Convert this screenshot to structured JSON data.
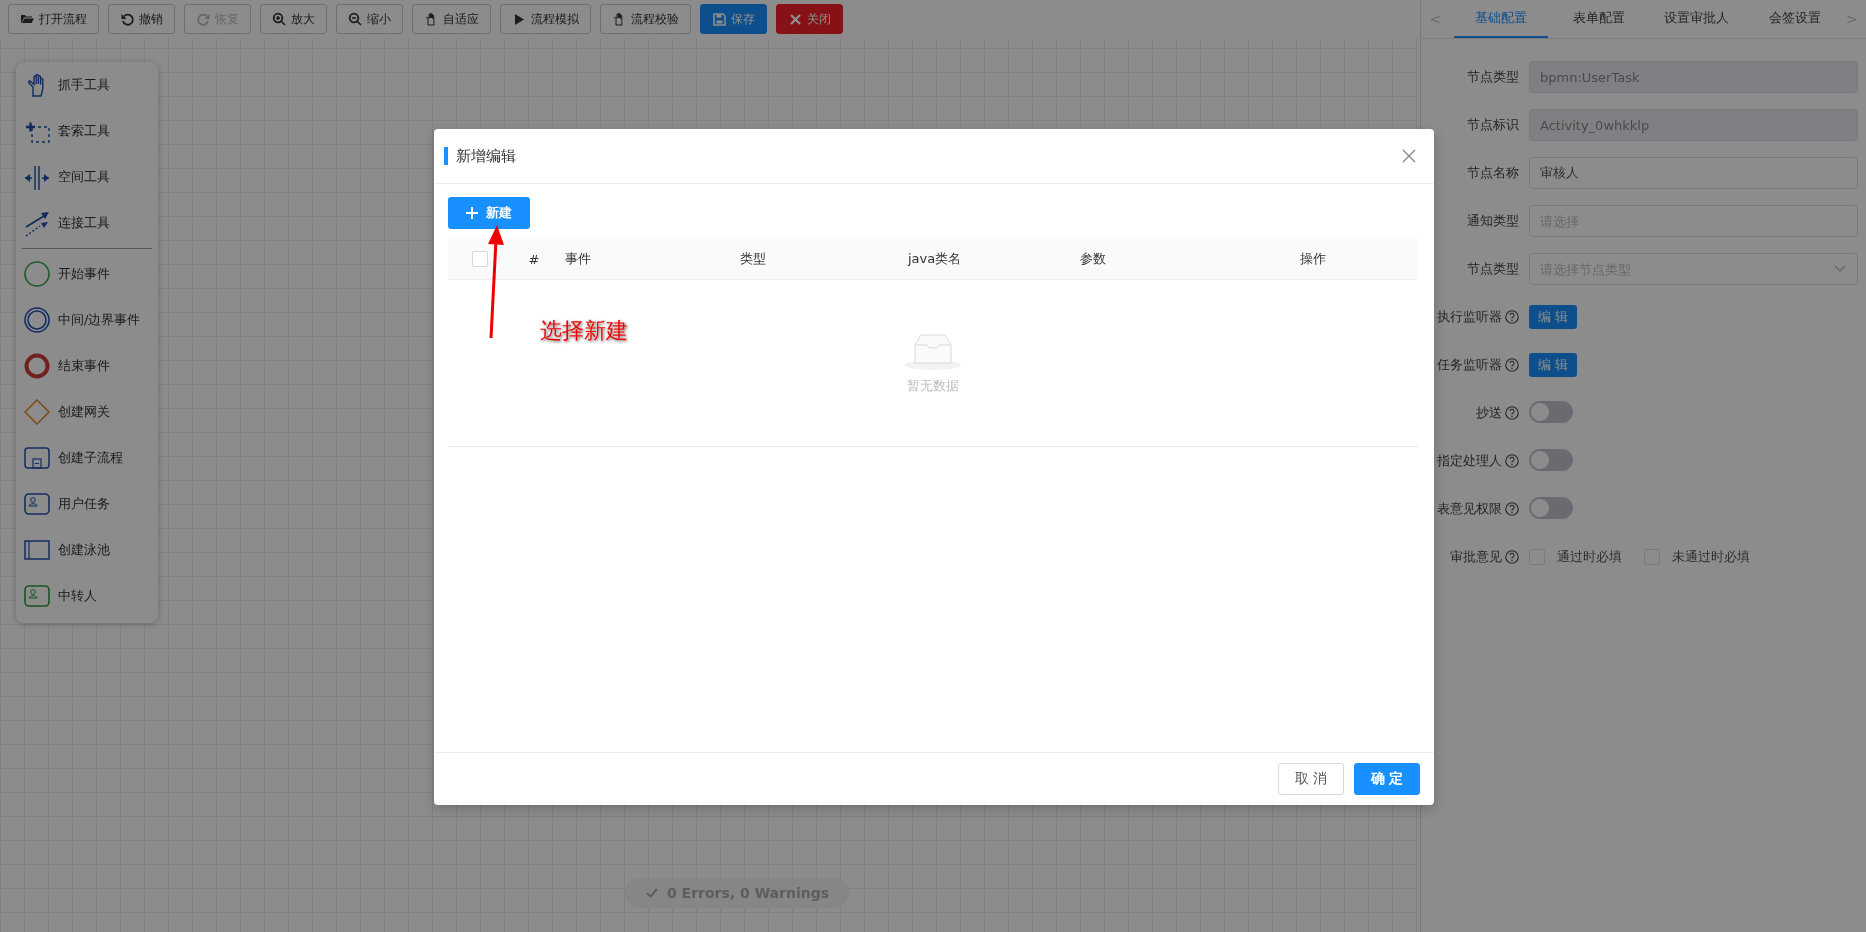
{
  "toolbar": {
    "buttons": [
      {
        "label": "打开流程",
        "kind": "default",
        "disabled": false
      },
      {
        "label": "撤销",
        "kind": "default",
        "disabled": false
      },
      {
        "label": "恢复",
        "kind": "default",
        "disabled": true
      },
      {
        "label": "放大",
        "kind": "default",
        "disabled": false
      },
      {
        "label": "缩小",
        "kind": "default",
        "disabled": false
      },
      {
        "label": "自适应",
        "kind": "default",
        "disabled": false
      },
      {
        "label": "流程模拟",
        "kind": "default",
        "disabled": false
      },
      {
        "label": "流程校验",
        "kind": "default",
        "disabled": false
      },
      {
        "label": "保存",
        "kind": "primary",
        "disabled": false
      },
      {
        "label": "关闭",
        "kind": "danger",
        "disabled": false
      }
    ]
  },
  "palette": {
    "tools": [
      {
        "label": "抓手工具"
      },
      {
        "label": "套索工具"
      },
      {
        "label": "空间工具"
      },
      {
        "label": "连接工具"
      }
    ],
    "elements": [
      {
        "label": "开始事件"
      },
      {
        "label": "中间/边界事件"
      },
      {
        "label": "结束事件"
      },
      {
        "label": "创建网关"
      },
      {
        "label": "创建子流程"
      },
      {
        "label": "用户任务"
      },
      {
        "label": "创建泳池"
      },
      {
        "label": "中转人"
      }
    ]
  },
  "status": {
    "text": "0 Errors, 0 Warnings"
  },
  "properties_panel": {
    "prev": "<",
    "next": ">",
    "tabs": [
      {
        "label": "基础配置",
        "selected": true
      },
      {
        "label": "表单配置",
        "selected": false
      },
      {
        "label": "设置审批人",
        "selected": false
      },
      {
        "label": "会签设置",
        "selected": false
      }
    ],
    "fields": [
      {
        "kind": "input",
        "label": "节点类型",
        "value": "bpmn:UserTask",
        "disabled": true
      },
      {
        "kind": "input",
        "label": "节点标识",
        "value": "Activity_0whkklp",
        "disabled": true
      },
      {
        "kind": "input",
        "label": "节点名称",
        "value": "审核人",
        "disabled": false
      },
      {
        "kind": "input",
        "label": "通知类型",
        "placeholder": "请选择",
        "disabled": false
      },
      {
        "kind": "select",
        "label": "节点类型",
        "placeholder": "请选择节点类型"
      },
      {
        "kind": "button",
        "label": "执行监听器",
        "help": true,
        "button": "编 辑"
      },
      {
        "kind": "button",
        "label": "任务监听器",
        "help": true,
        "button": "编 辑"
      },
      {
        "kind": "switch",
        "label": "抄送",
        "help": true,
        "on": false
      },
      {
        "kind": "switch",
        "label": "指定处理人",
        "help": true,
        "on": false
      },
      {
        "kind": "switch",
        "label": "表意见权限",
        "help": true,
        "on": false
      },
      {
        "kind": "checkboxes",
        "label": "审批意见",
        "help": true,
        "options": [
          {
            "label": "通过时必填",
            "checked": false
          },
          {
            "label": "未通过时必填",
            "checked": false
          }
        ]
      }
    ]
  },
  "dialog": {
    "title": "新增编辑",
    "new_button": "新建",
    "table": {
      "select_all": {
        "checked": false
      },
      "columns": [
        "#",
        "事件",
        "类型",
        "java类名",
        "参数",
        "操作"
      ],
      "empty_text": "暂无数据"
    },
    "annotation": {
      "text": "选择新建"
    },
    "buttons": [
      {
        "label": "取 消",
        "kind": "default"
      },
      {
        "label": "确 定",
        "kind": "primary"
      }
    ]
  }
}
